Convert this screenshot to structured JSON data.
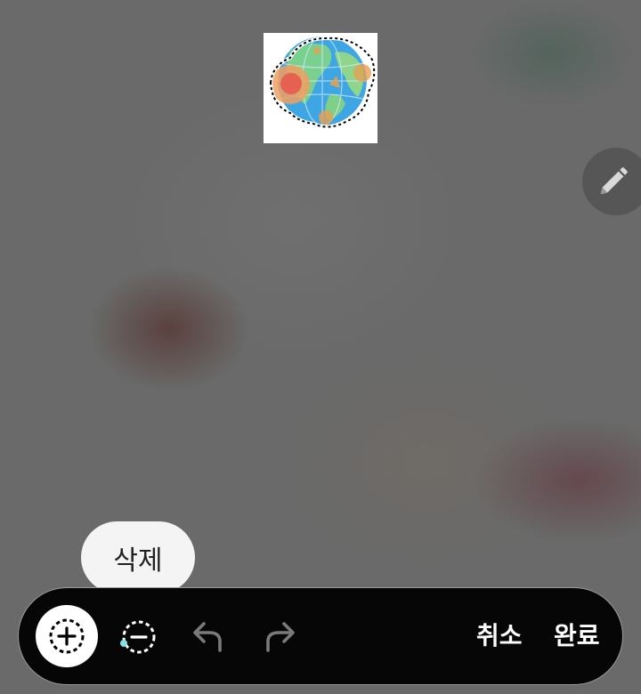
{
  "tooltip": {
    "label": "삭제"
  },
  "thumbnail": {
    "icon": "globe-icon"
  },
  "edit": {
    "icon": "pencil-icon"
  },
  "toolbar": {
    "add_icon": "selection-add-icon",
    "subtract_icon": "selection-subtract-icon",
    "undo_icon": "undo-icon",
    "redo_icon": "redo-icon",
    "cancel_label": "취소",
    "done_label": "완료"
  },
  "colors": {
    "toolbar_bg": "#060606",
    "tooltip_bg": "#f4f4f4",
    "accent": "#7fe3e0"
  }
}
